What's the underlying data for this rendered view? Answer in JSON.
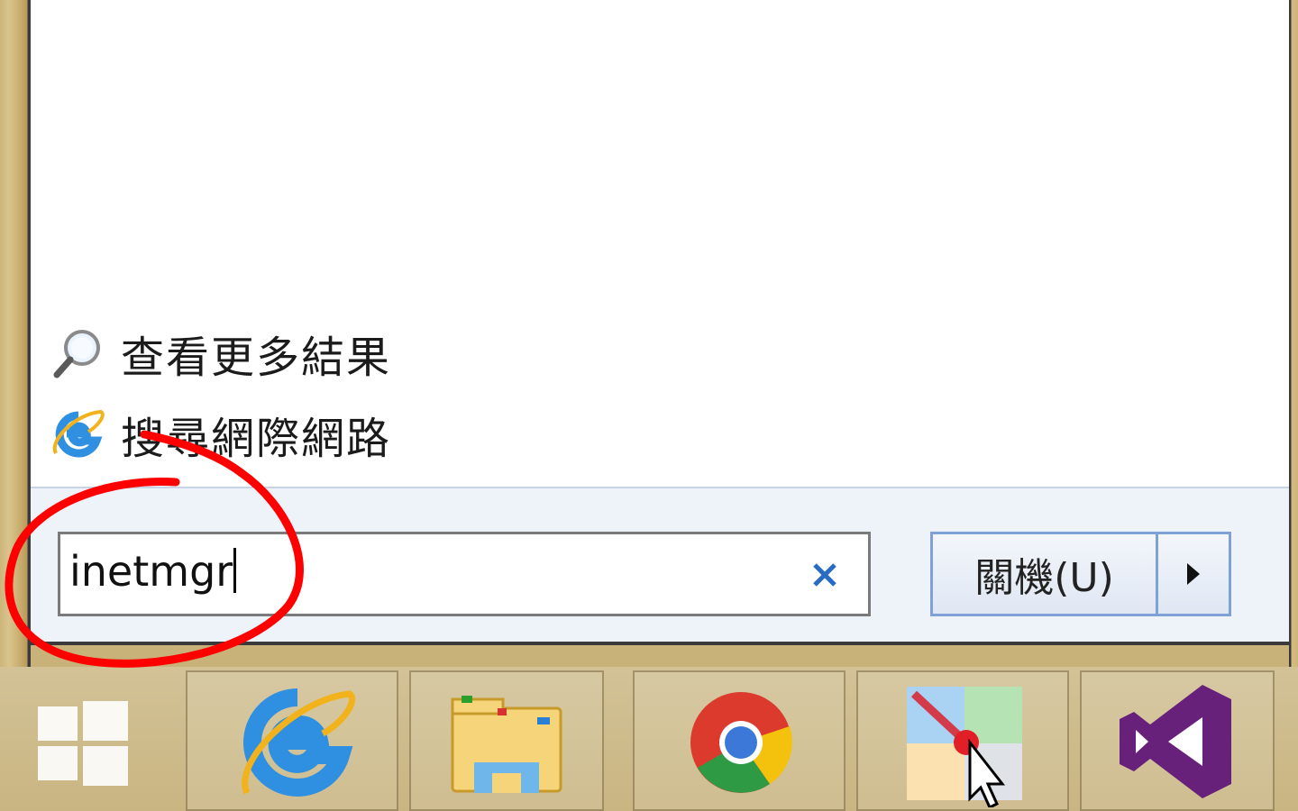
{
  "results": {
    "more_label": "查看更多結果",
    "web_label": "搜尋網際網路"
  },
  "search": {
    "value": "inetmgr",
    "clear_symbol": "×"
  },
  "shutdown": {
    "label": "關機(U)"
  },
  "taskbar": {
    "apps": [
      "start-icon",
      "internet-explorer-icon",
      "file-explorer-icon",
      "chrome-icon",
      "paint-app-icon",
      "visual-studio-icon"
    ]
  },
  "colors": {
    "accent": "#2a6bc4",
    "annotation": "#ff0000",
    "taskbar": "#c9b582"
  }
}
